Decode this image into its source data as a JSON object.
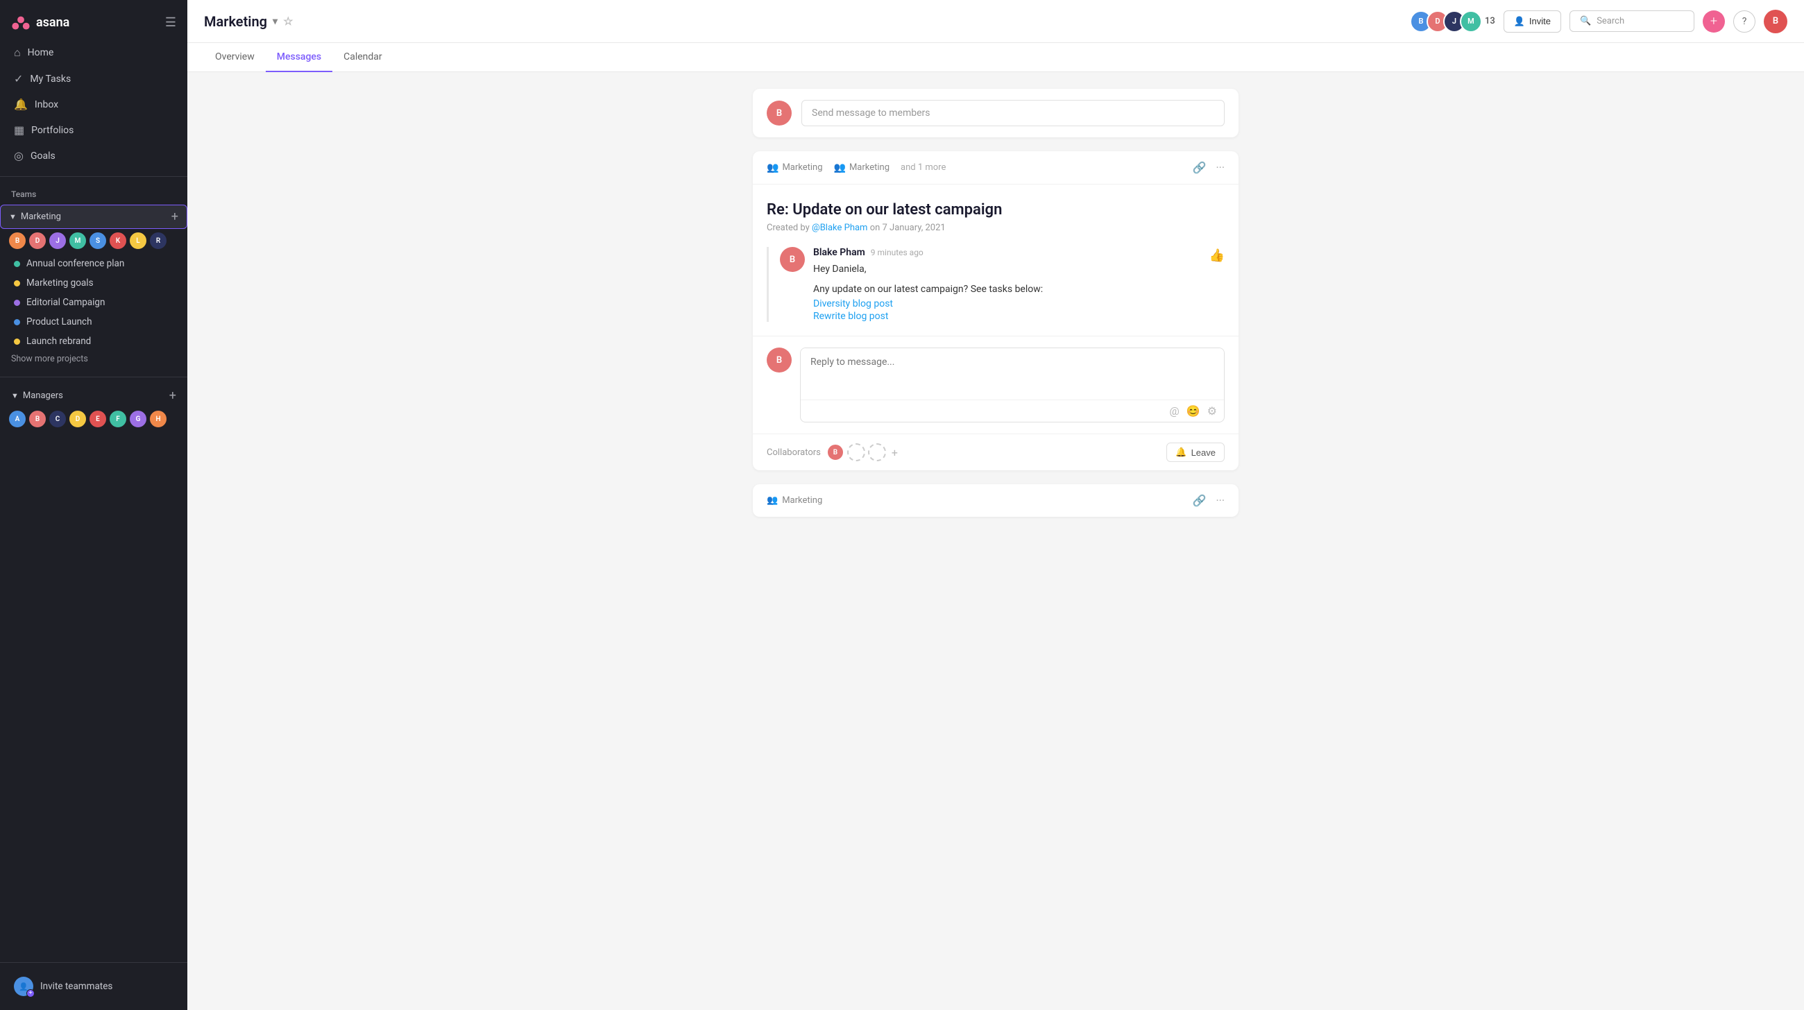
{
  "app": {
    "logo_text": "asana"
  },
  "sidebar": {
    "nav": [
      {
        "id": "home",
        "label": "Home",
        "icon": "⌂"
      },
      {
        "id": "my-tasks",
        "label": "My Tasks",
        "icon": "✓"
      },
      {
        "id": "inbox",
        "label": "Inbox",
        "icon": "🔔"
      },
      {
        "id": "portfolios",
        "label": "Portfolios",
        "icon": "📊"
      },
      {
        "id": "goals",
        "label": "Goals",
        "icon": "◎"
      }
    ],
    "teams_label": "Teams",
    "team": {
      "name": "Marketing",
      "projects": [
        {
          "id": "annual-conference",
          "label": "Annual conference plan",
          "color": "#40bfa3"
        },
        {
          "id": "marketing-goals",
          "label": "Marketing goals",
          "color": "#f5c842"
        },
        {
          "id": "editorial-campaign",
          "label": "Editorial Campaign",
          "color": "#9c6fe4"
        },
        {
          "id": "product-launch",
          "label": "Product Launch",
          "color": "#4a90e2"
        },
        {
          "id": "launch-rebrand",
          "label": "Launch rebrand",
          "color": "#f5c842"
        }
      ],
      "show_more": "Show more projects"
    },
    "team2": {
      "name": "Managers"
    },
    "invite": {
      "label": "Invite teammates"
    }
  },
  "topbar": {
    "project_name": "Marketing",
    "member_count": "13",
    "invite_label": "Invite",
    "search_placeholder": "Search"
  },
  "tabs": [
    {
      "id": "overview",
      "label": "Overview"
    },
    {
      "id": "messages",
      "label": "Messages"
    },
    {
      "id": "calendar",
      "label": "Calendar"
    }
  ],
  "active_tab": "messages",
  "compose": {
    "placeholder": "Send message to members"
  },
  "message1": {
    "meta_groups": [
      "Marketing",
      "Marketing",
      "and 1 more"
    ],
    "title": "Re: Update on our latest campaign",
    "created_by": "Created by",
    "mention": "@Blake Pham",
    "created_on": "on 7 January, 2021",
    "author": "Blake Pham",
    "time": "9 minutes ago",
    "greeting": "Hey Daniela,",
    "body": "Any update on our latest campaign? See tasks below:",
    "link1": "Diversity blog post",
    "link2": "Rewrite blog post",
    "reply_placeholder": "Reply to message...",
    "collaborators_label": "Collaborators",
    "leave_label": "Leave"
  },
  "message2": {
    "meta_group": "Marketing"
  }
}
